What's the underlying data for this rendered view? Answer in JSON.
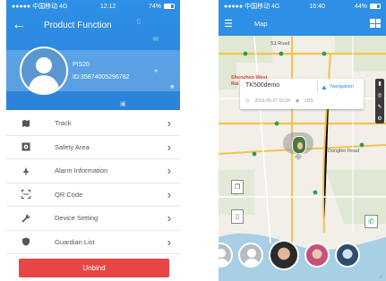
{
  "left": {
    "status": {
      "carrier": "●●●●● 中国移动 4G",
      "time": "12:12",
      "battery": "74%"
    },
    "title": "Product Function",
    "device": {
      "name": "PIS20",
      "id": "ID:35874005296782"
    },
    "menu": [
      {
        "icon": "map-icon",
        "label": "Track"
      },
      {
        "icon": "target-icon",
        "label": "Safety Area"
      },
      {
        "icon": "alarm-icon",
        "label": "Alarm Information"
      },
      {
        "icon": "qr-icon",
        "label": "QR Code"
      },
      {
        "icon": "wrench-icon",
        "label": "Device Setting"
      },
      {
        "icon": "shield-icon",
        "label": "Guardian List"
      }
    ],
    "unbind_label": "Unbind",
    "colors": {
      "header": "#2d8fe6",
      "unbind": "#e84545"
    }
  },
  "right": {
    "status": {
      "carrier": "●●●●● 中国移动 4G",
      "time": "16:40",
      "battery": "44%"
    },
    "title": "Map",
    "map_labels": {
      "road": "S1 Road",
      "station_1": "Shenzhen West",
      "station_2": "Rai",
      "district": "Dongbin Road"
    },
    "popup": {
      "device": "TK500demo",
      "nav_label": "Navigation",
      "time": "2016-05-27 15:34",
      "source": "LBS"
    },
    "attribution": "©"
  }
}
